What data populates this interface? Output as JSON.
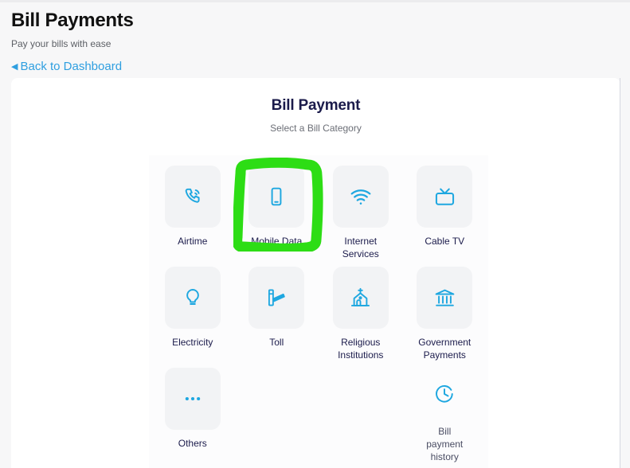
{
  "header": {
    "title": "Bill Payments",
    "subtitle": "Pay your bills with ease",
    "back_link": "Back to Dashboard",
    "back_caret": "◀"
  },
  "card": {
    "title": "Bill Payment",
    "subtitle": "Select a Bill Category"
  },
  "categories": [
    {
      "label": "Airtime",
      "icon": "phone-call-icon"
    },
    {
      "label": "Mobile Data",
      "icon": "smartphone-icon"
    },
    {
      "label": "Internet\nServices",
      "icon": "wifi-icon"
    },
    {
      "label": "Cable TV",
      "icon": "television-icon"
    },
    {
      "label": "Electricity",
      "icon": "lightbulb-icon"
    },
    {
      "label": "Toll",
      "icon": "toll-barrier-icon"
    },
    {
      "label": "Religious\nInstitutions",
      "icon": "church-icon"
    },
    {
      "label": "Government\nPayments",
      "icon": "bank-building-icon"
    },
    {
      "label": "Others",
      "icon": "ellipsis-icon"
    },
    {
      "label": "",
      "icon": ""
    },
    {
      "label": "",
      "icon": ""
    },
    {
      "label": "Bill\npayment\nhistory",
      "icon": "clock-history-icon"
    }
  ],
  "annotation": {
    "type": "hand-drawn-rectangle",
    "target": "Mobile Data",
    "color": "#2ddd15"
  },
  "colors": {
    "accent_icon": "#1ea7e0",
    "link": "#2f9fe0",
    "title_navy": "#1b1b4b",
    "tile_bg": "#f2f3f5",
    "page_bg": "#f7f7f8",
    "card_bg": "#ffffff",
    "highlight_green": "#2ddd15"
  }
}
